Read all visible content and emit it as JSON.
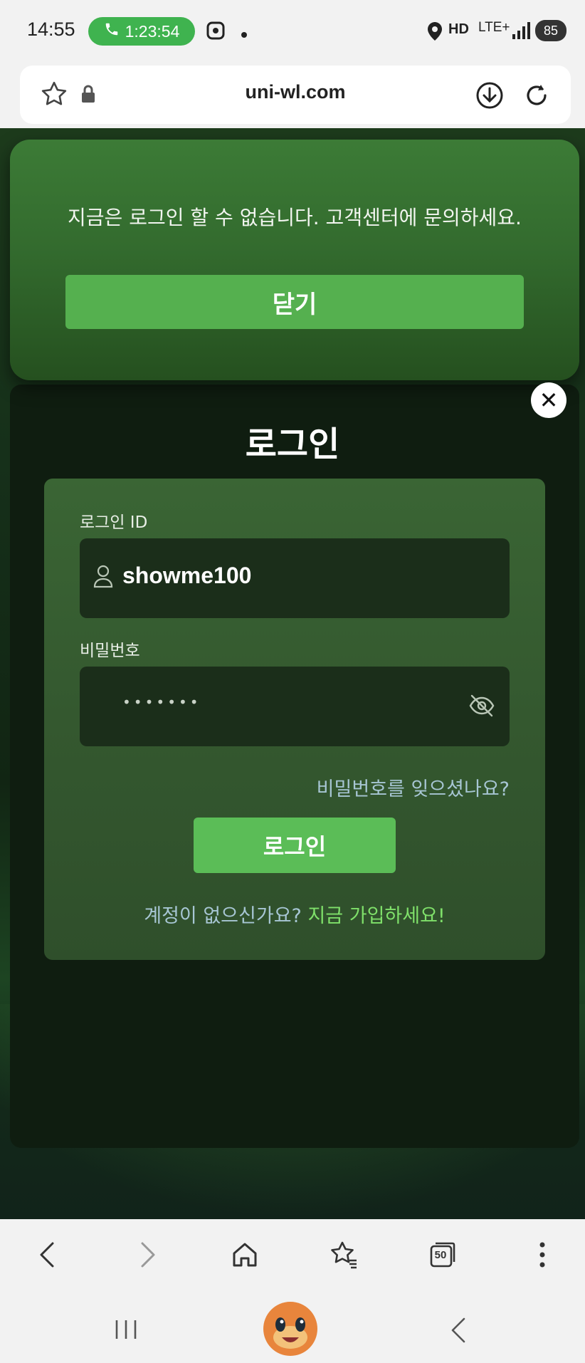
{
  "status_bar": {
    "time": "14:55",
    "call_timer": "1:23:54",
    "network": "LTE+",
    "hd_label": "HD",
    "battery": "85"
  },
  "browser": {
    "url": "uni-wl.com"
  },
  "alert": {
    "message": "지금은 로그인 할 수 없습니다. 고객센터에 문의하세요.",
    "close_label": "닫기"
  },
  "login": {
    "title": "로그인",
    "id_label": "로그인 ID",
    "id_value": "showme100",
    "password_label": "비밀번호",
    "password_masked": "•••••••",
    "forgot_label": "비밀번호를 잊으셨나요?",
    "submit_label": "로그인",
    "signup_question": "계정이 없으신가요?",
    "signup_link": "지금 가입하세요!"
  },
  "bottom_nav": {
    "tabs_count": "50"
  },
  "colors": {
    "accent_green": "#55b04f",
    "call_pill": "#3fb34f",
    "link_green": "#7fe06a"
  }
}
